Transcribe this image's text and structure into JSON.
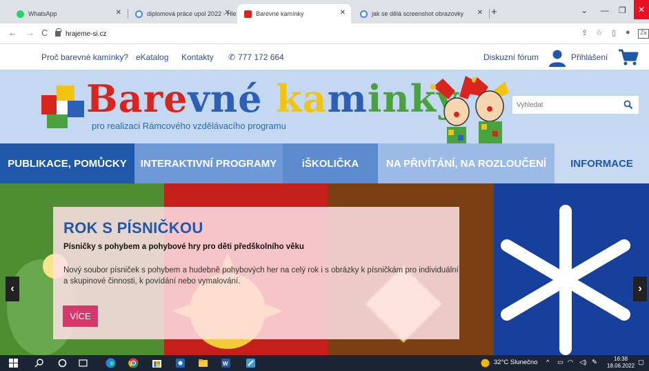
{
  "browser": {
    "tabs": [
      {
        "title": "WhatsApp",
        "color": "#25d366"
      },
      {
        "title": "diplomová práce upol 2022 - Hle",
        "color": "#4285f4"
      },
      {
        "title": "Barevné kamínky",
        "color": "#d8261f"
      },
      {
        "title": "jak se dělá screenshot obrazovky",
        "color": "#4285f4"
      }
    ],
    "url": "hrajeme-si.cz"
  },
  "topnav": {
    "why": "Proč barevné kamínky?",
    "catalog": "eKatalog",
    "contacts": "Kontakty",
    "phone": "777 172 664",
    "forum": "Diskuzní fórum",
    "login": "Přihlášení"
  },
  "header": {
    "title_parts": [
      "B",
      "are",
      "vné",
      " ka",
      "m",
      "inky"
    ],
    "subtitle": "pro realizaci Rámcového vzdělávacího programu",
    "search_placeholder": "Vyhledat"
  },
  "mainnav": [
    "PUBLIKACE, POMŮCKY",
    "INTERAKTIVNÍ PROGRAMY",
    "iŠKOLIČKA",
    "NA PŘIVÍTÁNÍ, NA ROZLOUČENÍ",
    "INFORMACE"
  ],
  "slide": {
    "title": "ROK S PÍSNIČKOU",
    "subtitle": "Písničky s pohybem a pohybové hry pro děti předškolního věku",
    "text": "Nový soubor písniček s pohybem a hudebně pohybových her na celý rok i s obrázky k písničkám pro individuální a skupinové činnosti, k povídání nebo vymalování.",
    "button": "VÍCE"
  },
  "taskbar": {
    "weather": "32°C Slunečno",
    "time": "16:38",
    "date": "18.06.2022"
  },
  "colors": {
    "brand_blue": "#1f57a9",
    "accent_pink": "#d8376b",
    "header_bg": "#c5d8f1"
  }
}
